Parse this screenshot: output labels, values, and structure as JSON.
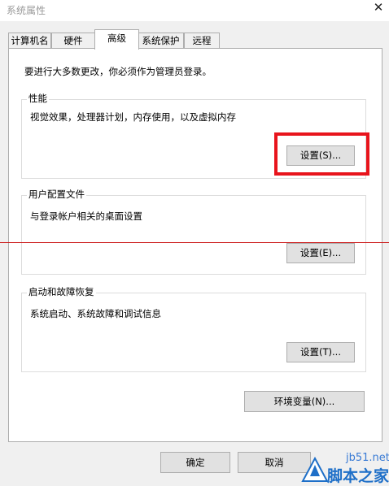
{
  "window": {
    "title": "系统属性",
    "close_glyph": "✕"
  },
  "tabs": [
    {
      "label": "计算机名"
    },
    {
      "label": "硬件"
    },
    {
      "label": "高级",
      "active": true
    },
    {
      "label": "系统保护"
    },
    {
      "label": "远程"
    }
  ],
  "notice": "要进行大多数更改，你必须作为管理员登录。",
  "performance": {
    "title": "性能",
    "description": "视觉效果，处理器计划，内存使用，以及虚拟内存",
    "button": "设置(S)..."
  },
  "user_profiles": {
    "title": "用户配置文件",
    "description": "与登录帐户相关的桌面设置",
    "button": "设置(E)..."
  },
  "startup_recovery": {
    "title": "启动和故障恢复",
    "description": "系统启动、系统故障和调试信息",
    "button": "设置(T)..."
  },
  "env_button": "环境变量(N)...",
  "footer": {
    "ok": "确定",
    "cancel": "取消"
  },
  "watermark": {
    "url": "jb51.net",
    "text": "脚本之家"
  },
  "colors": {
    "highlight": "#e8141c",
    "accent_line": "#cc1b1b",
    "watermark": "#1e6fc8"
  }
}
